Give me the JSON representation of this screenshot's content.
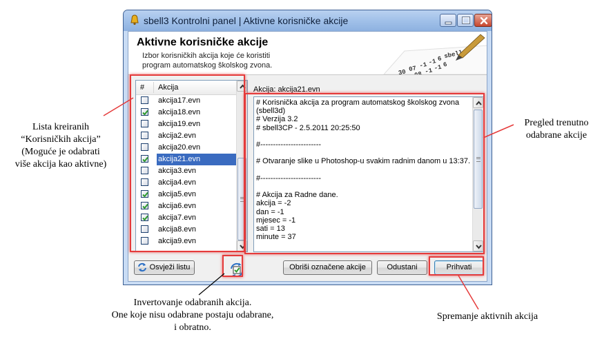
{
  "window": {
    "title": "sbell3 Kontrolni panel | Aktivne korisničke akcije",
    "controls": [
      "minimize-icon",
      "maximize-icon",
      "close-icon"
    ]
  },
  "header": {
    "title": "Aktivne korisničke akcije",
    "subtitle_line1": "Izbor korisničkih akcija koje će koristiti",
    "subtitle_line2": "program automatskog školskog zvona."
  },
  "list": {
    "col_num": "#",
    "col_name": "Akcija",
    "items": [
      {
        "name": "akcija17.evn",
        "checked": false,
        "selected": false
      },
      {
        "name": "akcija18.evn",
        "checked": true,
        "selected": false
      },
      {
        "name": "akcija19.evn",
        "checked": false,
        "selected": false
      },
      {
        "name": "akcija2.evn",
        "checked": false,
        "selected": false
      },
      {
        "name": "akcija20.evn",
        "checked": false,
        "selected": false
      },
      {
        "name": "akcija21.evn",
        "checked": true,
        "selected": true
      },
      {
        "name": "akcija3.evn",
        "checked": false,
        "selected": false
      },
      {
        "name": "akcija4.evn",
        "checked": false,
        "selected": false
      },
      {
        "name": "akcija5.evn",
        "checked": true,
        "selected": false
      },
      {
        "name": "akcija6.evn",
        "checked": true,
        "selected": false
      },
      {
        "name": "akcija7.evn",
        "checked": true,
        "selected": false
      },
      {
        "name": "akcija8.evn",
        "checked": false,
        "selected": false
      },
      {
        "name": "akcija9.evn",
        "checked": false,
        "selected": false
      }
    ]
  },
  "preview": {
    "label": "Akcija: akcija21.evn",
    "lines": [
      "# Korisnička akcija za program automatskog školskog zvona",
      "(sbell3d)",
      "# Verzija 3.2",
      "# sbell3CP - 2.5.2011 20:25:50",
      "",
      "#------------------------",
      "",
      "# Otvaranje slike u Photoshop-u svakim radnim danom u 13:37.",
      "",
      "#------------------------",
      "",
      "# Akcija za Radne dane.",
      "akcija = -2",
      "dan = -1",
      "mjesec = -1",
      "sati = 13",
      "minute = 37"
    ]
  },
  "buttons": {
    "refresh": "Osvježi listu",
    "delete_selected": "Obriši označene akcije",
    "cancel": "Odustani",
    "accept": "Prihvati"
  },
  "annotations": {
    "list": [
      "Lista kreiranih",
      "“Korisničkih akcija”",
      "(Moguće je odabrati",
      "više akcija kao aktivne)"
    ],
    "preview": [
      "Pregled trenutno",
      "odabrane akcije"
    ],
    "invert": [
      "Invertovanje odabranih akcija.",
      "One koje nisu odabrane postaju odabrane,",
      "i obratno."
    ],
    "save": [
      "Spremanje aktivnih akcija"
    ]
  },
  "header_art_text": [
    "30",
    "07",
    "-1",
    "-1",
    "6",
    "sbell",
    "20",
    "08",
    "-1",
    "-1",
    "6"
  ],
  "colors": {
    "highlight": "#e53a3a",
    "selection": "#3a6bc0",
    "check": "#2e9a2e",
    "titlebar": "#9fbfe8"
  }
}
